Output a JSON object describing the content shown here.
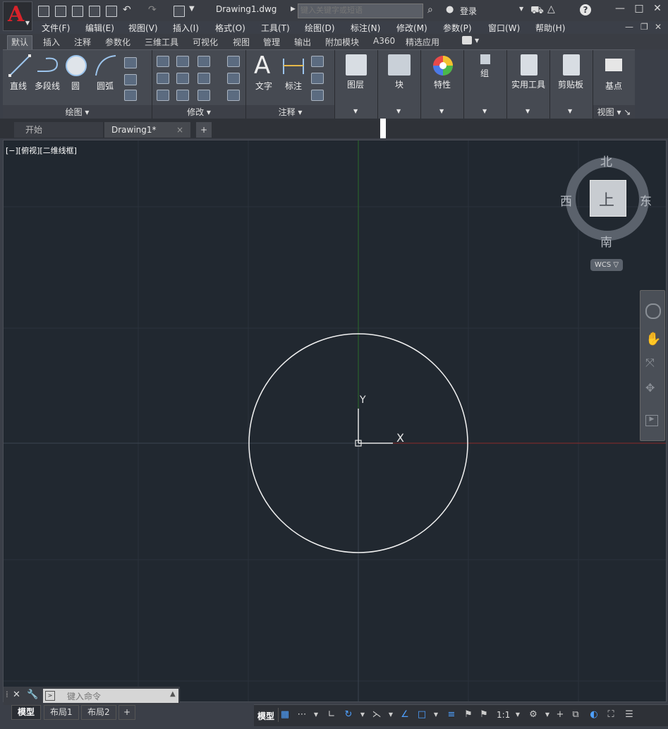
{
  "app": {
    "logo_letter": "A",
    "document_title": "Drawing1.dwg",
    "search_placeholder": "键入关键字或短语",
    "login_label": "登录",
    "help_label": "?"
  },
  "menus": [
    "文件(F)",
    "编辑(E)",
    "视图(V)",
    "插入(I)",
    "格式(O)",
    "工具(T)",
    "绘图(D)",
    "标注(N)",
    "修改(M)",
    "参数(P)",
    "窗口(W)",
    "帮助(H)"
  ],
  "ribbon_tabs": [
    "默认",
    "插入",
    "注释",
    "参数化",
    "三维工具",
    "可视化",
    "视图",
    "管理",
    "输出",
    "附加模块",
    "A360",
    "精选应用"
  ],
  "active_ribbon_tab": "默认",
  "ribbon": {
    "draw": {
      "line": "直线",
      "polyline": "多段线",
      "circle": "圆",
      "arc": "圆弧",
      "panel_title": "绘图"
    },
    "modify": {
      "panel_title": "修改"
    },
    "annotation": {
      "text": "文字",
      "dimension": "标注",
      "panel_title": "注释"
    },
    "layers": "图层",
    "block": "块",
    "properties": "特性",
    "groups": "组",
    "utilities": "实用工具",
    "clipboard": "剪贴板",
    "view": {
      "base": "基点",
      "panel_title": "视图"
    }
  },
  "file_tabs": {
    "start": "开始",
    "drawing": "Drawing1*",
    "close": "×",
    "new": "+"
  },
  "viewport": {
    "label": "[−][俯视][二维线框]",
    "compass": {
      "north": "北",
      "south": "南",
      "east": "东",
      "west": "西",
      "top": "上"
    },
    "wcs_label": "WCS",
    "ucs_x": "X",
    "ucs_y": "Y"
  },
  "command_line": {
    "placeholder": "键入命令"
  },
  "layout_tabs": [
    "模型",
    "布局1",
    "布局2"
  ],
  "layout_add": "+",
  "status_bar": {
    "model": "模型",
    "scale": "1:1"
  },
  "colors": {
    "canvas": "#212830",
    "x_axis": "#8b2a2a",
    "y_axis": "#2a6b2a",
    "circle": "#f2f2f2",
    "logo_red": "#d8232a"
  }
}
